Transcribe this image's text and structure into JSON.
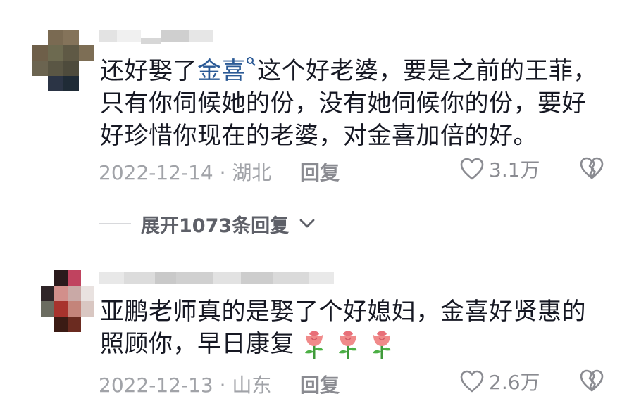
{
  "comments": [
    {
      "text_prefix": "还好娶了",
      "link_text": "金喜",
      "text_suffix": "这个好老婆，要是之前的王菲，只有你伺候她的份，没有她伺候你的份，要好好珍惜你现在的老婆，对金喜加倍的好。",
      "date_location": "2022-12-14 · 湖北",
      "reply_label": "回复",
      "like_count": "3.1万"
    },
    {
      "text": "亚鹏老师真的是娶了个好媳妇，金喜好贤惠的照顾你，早日康复",
      "emoji_count": 3,
      "date_location": "2022-12-13 · 山东",
      "reply_label": "回复",
      "like_count": "2.6万"
    }
  ],
  "expand_replies": "展开1073条回复",
  "icons": {
    "like": "heart-outline-icon",
    "dislike": "broken-heart-icon",
    "expand": "chevron-down-icon",
    "link": "search-icon",
    "emoji": "rose-emoji-icon"
  },
  "colors": {
    "text": "#161823",
    "link": "#2b5a96",
    "meta": "#a1a3a8",
    "rose": "#f08a8a"
  }
}
